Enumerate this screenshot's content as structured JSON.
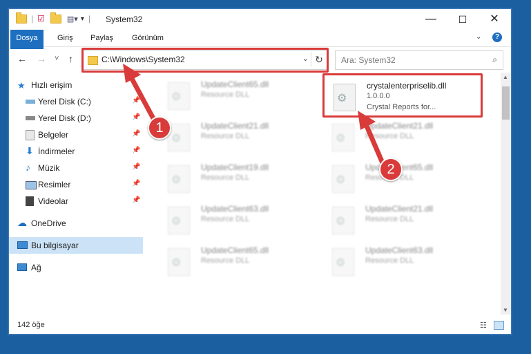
{
  "window": {
    "title": "System32",
    "controls": {
      "minimize": "—",
      "maximize": "☐",
      "close": "✕"
    }
  },
  "ribbon": {
    "tabs": [
      "Dosya",
      "Giriş",
      "Paylaş",
      "Görünüm"
    ],
    "help_icon": "?"
  },
  "navbar": {
    "back": "←",
    "forward": "→",
    "recent": "˅",
    "up": "↑",
    "address": "C:\\Windows\\System32",
    "search_placeholder": "Ara: System32"
  },
  "nav_pane": {
    "quick_access": "Hızlı erişim",
    "items": [
      {
        "label": "Yerel Disk (C:)",
        "pinned": true
      },
      {
        "label": "Yerel Disk (D:)",
        "pinned": true
      },
      {
        "label": "Belgeler",
        "pinned": true
      },
      {
        "label": "İndirmeler",
        "pinned": true
      },
      {
        "label": "Müzik",
        "pinned": true
      },
      {
        "label": "Resimler",
        "pinned": true
      },
      {
        "label": "Videolar",
        "pinned": true
      }
    ],
    "onedrive": "OneDrive",
    "this_pc": "Bu bilgisayar",
    "network": "Ağ"
  },
  "files": {
    "left": [
      {
        "name": "UpdateClient65.dll",
        "type": "Resource DLL"
      },
      {
        "name": "UpdateClient21.dll",
        "type": "Resource DLL"
      },
      {
        "name": "UpdateClient19.dll",
        "type": "Resource DLL"
      },
      {
        "name": "UpdateClient63.dll",
        "type": "Resource DLL"
      },
      {
        "name": "UpdateClient65.dll",
        "type": "Resource DLL"
      }
    ],
    "right": [
      {
        "name": "crystalenterpriselib.dll",
        "version": "1.0.0.0",
        "type": "Crystal Reports for..."
      },
      {
        "name": "UpdateClient21.dll",
        "type": "Resource DLL"
      },
      {
        "name": "UpdateClient65.dll",
        "type": "Resource DLL"
      },
      {
        "name": "UpdateClient21.dll",
        "type": "Resource DLL"
      },
      {
        "name": "UpdateClient63.dll",
        "type": "Resource DLL"
      }
    ]
  },
  "status": {
    "count": "142 öğe"
  },
  "annotations": {
    "step1": "1",
    "step2": "2",
    "color": "#d93a3a"
  }
}
